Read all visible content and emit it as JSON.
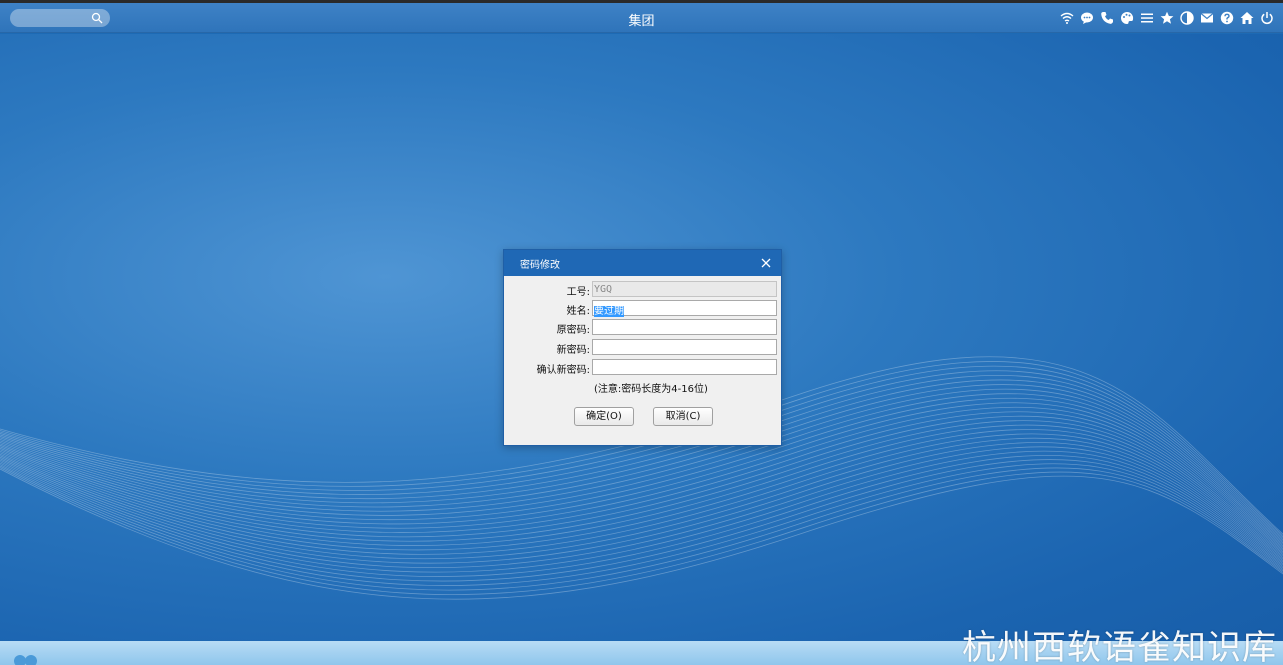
{
  "topbar": {
    "title": "集团",
    "icons": [
      "wifi-icon",
      "message-icon",
      "phone-icon",
      "palette-icon",
      "menu-icon",
      "star-icon",
      "theme-icon",
      "mail-icon",
      "help-icon",
      "home-icon",
      "power-icon"
    ]
  },
  "search": {
    "placeholder": ""
  },
  "dialog": {
    "title": "密码修改",
    "fields": {
      "id_label": "工号:",
      "id_value": "YGQ",
      "name_label": "姓名:",
      "name_value": "要过期",
      "old_label": "原密码:",
      "new_label": "新密码:",
      "confirm_label": "确认新密码:"
    },
    "note": "(注意:密码长度为4-16位)",
    "ok_label": "确定(O)",
    "cancel_label": "取消(C)"
  },
  "watermark": "杭州西软语雀知识库",
  "colors": {
    "accent": "#1f68b5",
    "desktop": "#2d79c0",
    "taskbar": "#a6d2f1"
  }
}
